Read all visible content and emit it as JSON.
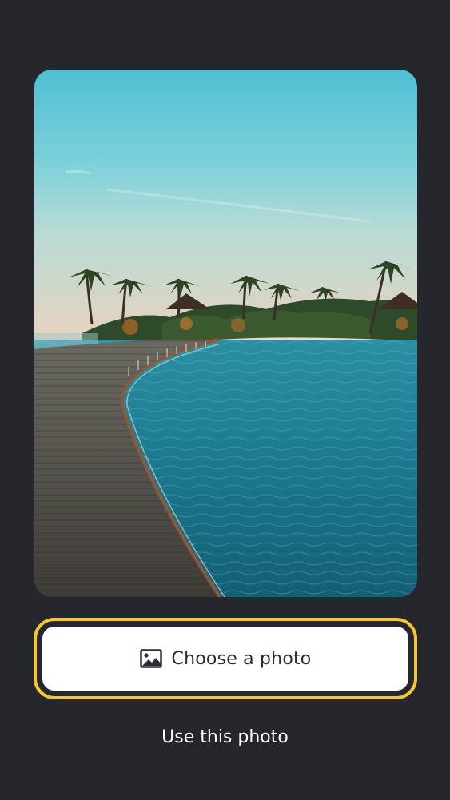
{
  "preview": {
    "image_subject": "beach-boardwalk-photo"
  },
  "actions": {
    "choose_label": "Choose a photo",
    "choose_icon": "image-icon",
    "use_label": "Use this photo"
  },
  "colors": {
    "background": "#25272c",
    "focus_ring": "#f4c534",
    "button_fill": "#ffffff"
  }
}
